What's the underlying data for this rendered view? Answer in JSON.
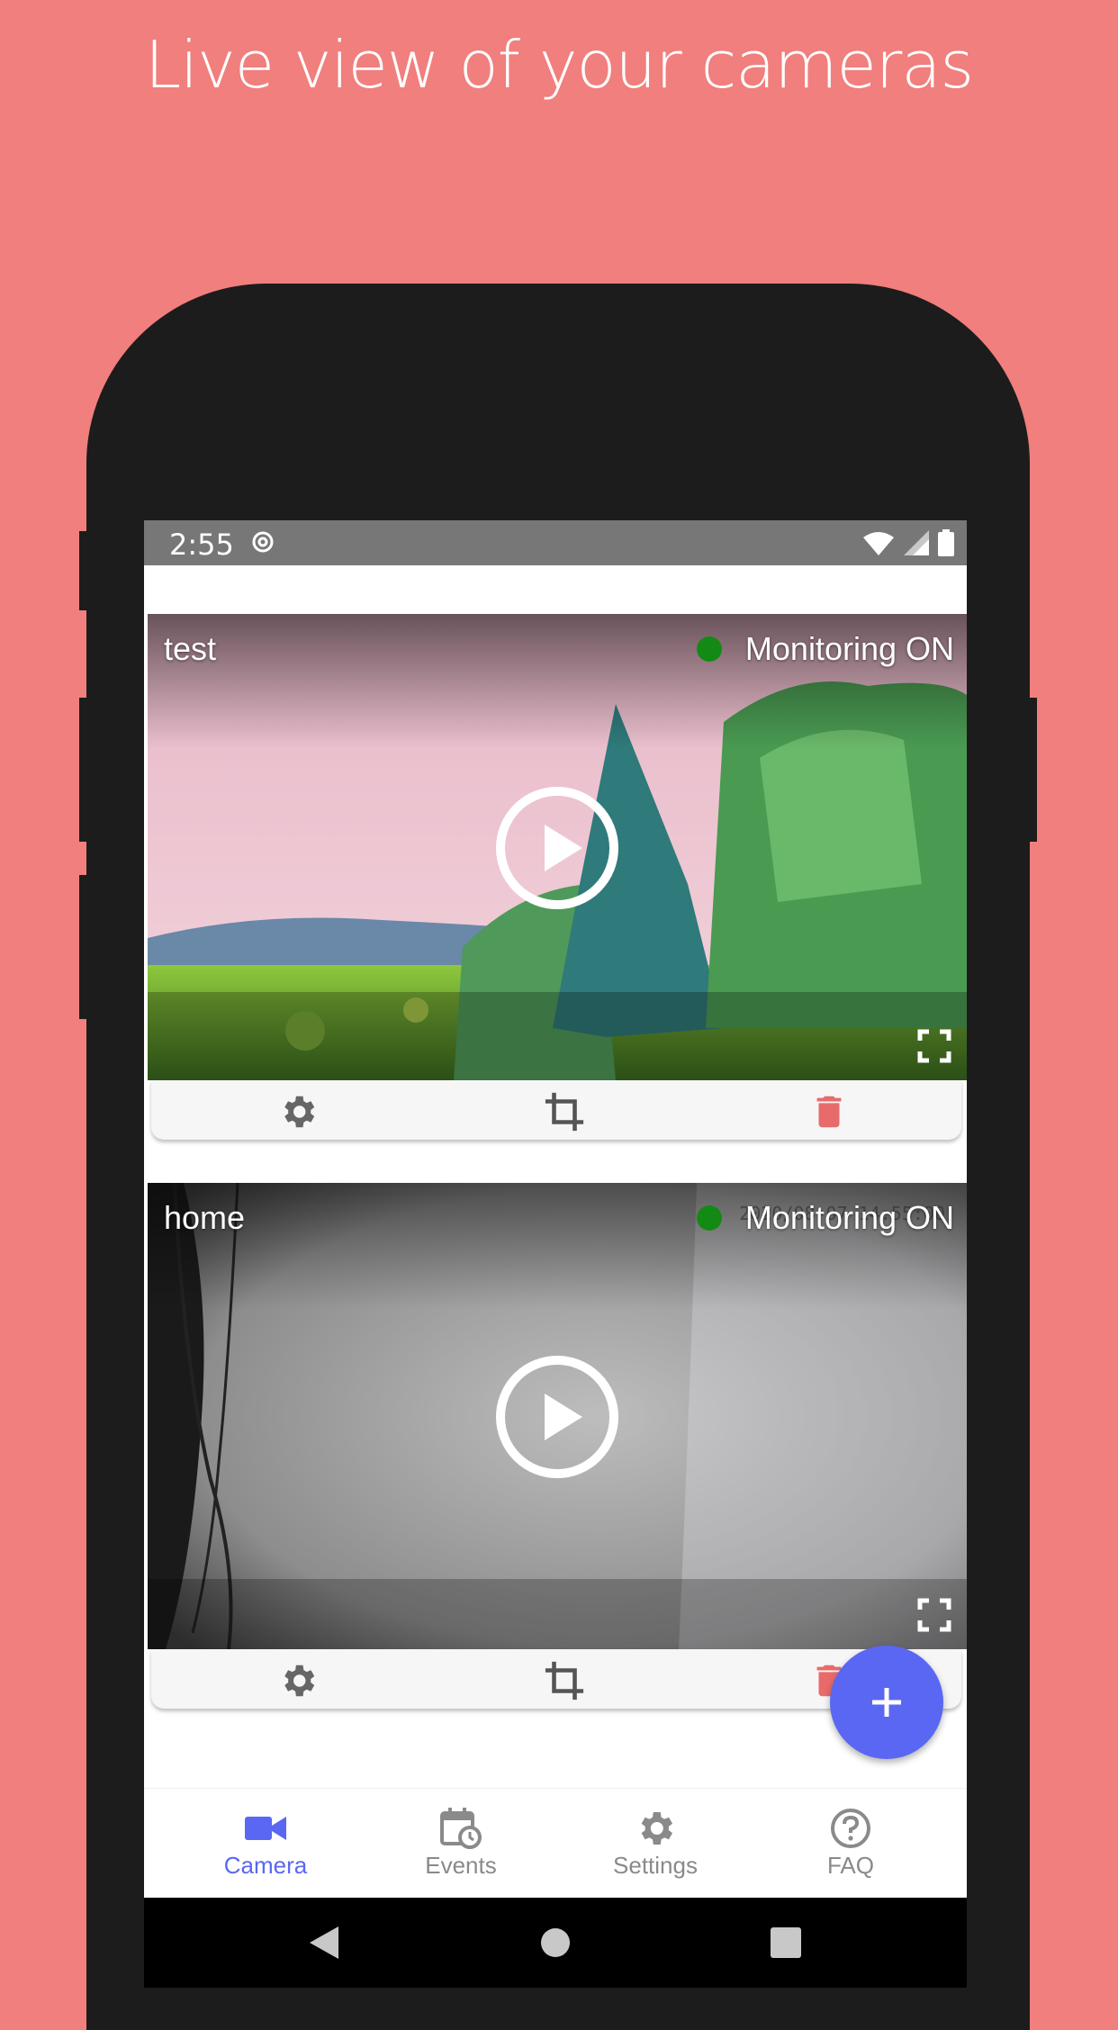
{
  "headline": "Live view of your cameras",
  "colors": {
    "background": "#f07f7d",
    "accent": "#5a67f3",
    "delete": "#e86b6b",
    "monitoring_dot": "#138a13"
  },
  "status_bar": {
    "time": "2:55",
    "icons": [
      "sync-icon",
      "wifi-icon",
      "cellular-icon",
      "battery-icon"
    ]
  },
  "cameras": [
    {
      "name": "test",
      "monitoring_label": "Monitoring ON",
      "actions": [
        "settings-icon",
        "crop-icon",
        "delete-icon"
      ]
    },
    {
      "name": "home",
      "monitoring_label": "Monitoring ON",
      "overlay_text": "2020/08-07 14:55:00",
      "actions": [
        "settings-icon",
        "crop-icon",
        "delete-icon"
      ]
    }
  ],
  "fab": {
    "icon": "plus-icon"
  },
  "bottom_nav": {
    "items": [
      {
        "label": "Camera",
        "icon": "videocam-icon",
        "active": true
      },
      {
        "label": "Events",
        "icon": "calendar-clock-icon",
        "active": false
      },
      {
        "label": "Settings",
        "icon": "gear-icon",
        "active": false
      },
      {
        "label": "FAQ",
        "icon": "help-icon",
        "active": false
      }
    ]
  },
  "system_nav": [
    "back-icon",
    "home-icon",
    "recents-icon"
  ]
}
